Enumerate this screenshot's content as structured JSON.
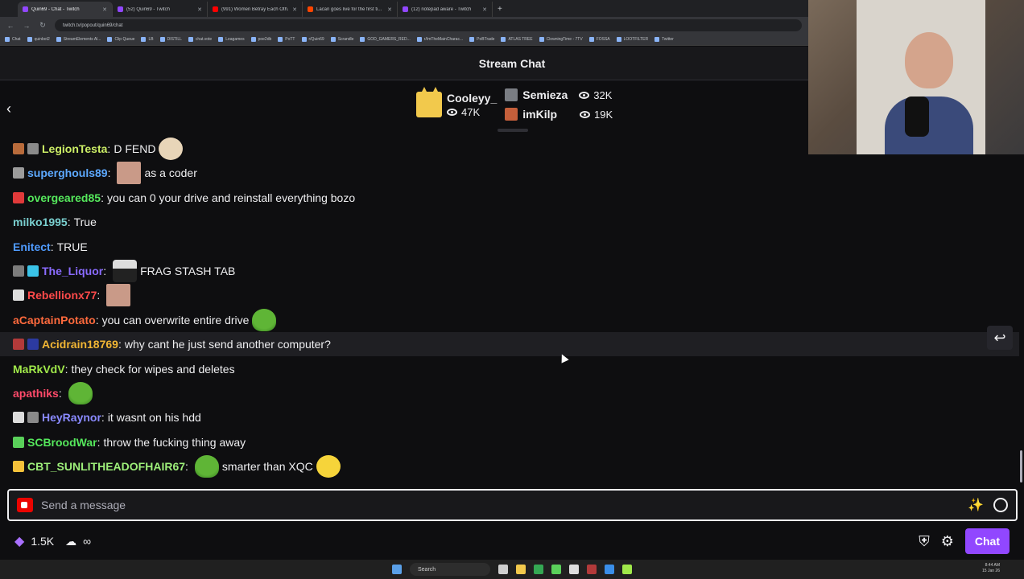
{
  "browser": {
    "tabs": [
      {
        "title": "Quin69 - Chat - Twitch",
        "active": true,
        "fav": "twitch"
      },
      {
        "title": "(52) Quin69 - Twitch",
        "active": false,
        "fav": "twitch"
      },
      {
        "title": "(991) Women Betray Each Oth...",
        "active": false,
        "fav": "youtube"
      },
      {
        "title": "Lacari goes live for the first ti...",
        "active": false,
        "fav": "reddit"
      },
      {
        "title": "(12) notepad aware - Twitch",
        "active": false,
        "fav": "twitch"
      }
    ],
    "new_tab": "+",
    "url": "twitch.tv/popout/quin69/chat",
    "bookmarks": [
      "Chat",
      "quinbot2",
      "StreamElements Al...",
      "Clip Queue",
      "LB",
      "DISTILL",
      "chat.vote",
      "Leagames",
      "poe2db",
      "PoTT",
      "r/Quin69",
      "Scrandle",
      "GOD_GAMERS_RED...",
      "r/ImTheMainCharac...",
      "PoBTrade",
      "ATLAS TREE",
      "ClowningTime - 7TV",
      "FOSSA",
      "LOOTFILTER",
      "Twitter"
    ]
  },
  "header": {
    "title": "Stream Chat"
  },
  "hype_train": {
    "top": {
      "name": "Cooleyy_",
      "viewers": "47K"
    },
    "others": [
      {
        "name": "Semieza",
        "viewers": "32K"
      },
      {
        "name": "imKilp",
        "viewers": "19K"
      }
    ]
  },
  "messages": [
    {
      "user": "LegionTesta",
      "color": "#ccee66",
      "text": "D FEND",
      "emote_before": false,
      "emote_after": "troll",
      "badges": [
        "#b86b3b",
        "#8a8a8a"
      ]
    },
    {
      "user": "superghouls89",
      "color": "#5da9ff",
      "text": "as a coder",
      "emote_before": "face",
      "emote_after": false,
      "badges": [
        "#9b9b9b"
      ]
    },
    {
      "user": "overgeared85",
      "color": "#55e85c",
      "text": "you can 0 your drive and reinstall everything bozo",
      "emote_before": false,
      "emote_after": false,
      "badges": [
        "#e03a3a"
      ]
    },
    {
      "user": "milko1995",
      "color": "#7ad0d0",
      "text": "True",
      "emote_before": false,
      "emote_after": false,
      "badges": []
    },
    {
      "user": "Enitect",
      "color": "#4f9bff",
      "text": "TRUE",
      "emote_before": false,
      "emote_after": false,
      "badges": []
    },
    {
      "user": "The_Liquor",
      "color": "#8a6bff",
      "text": "FRAG STASH TAB",
      "emote_before": "suit",
      "emote_after": false,
      "badges": [
        "#7c7c7c",
        "#3ac3e8"
      ]
    },
    {
      "user": "Rebellionx77",
      "color": "#ff4a4a",
      "text": "",
      "emote_before": false,
      "emote_after": "face",
      "badges": [
        "#dddddd"
      ]
    },
    {
      "user": "aCaptainPotato",
      "color": "#ff6a3d",
      "text": "you can overwrite entire drive",
      "emote_before": false,
      "emote_after": "pepe",
      "badges": []
    },
    {
      "user": "Acidrain18769",
      "color": "#f2b634",
      "text": "why cant he just send another computer?",
      "emote_before": false,
      "emote_after": false,
      "badges": [
        "#b23a3a",
        "#2c3aa0"
      ],
      "hover": true
    },
    {
      "user": "MaRkVdV",
      "color": "#a0e84a",
      "text": "they check for wipes and deletes",
      "emote_before": false,
      "emote_after": false,
      "badges": []
    },
    {
      "user": "apathiks",
      "color": "#ff4a6a",
      "text": "",
      "emote_before": false,
      "emote_after": "pepe",
      "badges": []
    },
    {
      "user": "HeyRaynor",
      "color": "#8a8aff",
      "text": "it wasnt on his hdd",
      "emote_before": false,
      "emote_after": false,
      "badges": [
        "#dddddd",
        "#8a8a8a"
      ]
    },
    {
      "user": "SCBroodWar",
      "color": "#55e85c",
      "text": "throw the fucking thing away",
      "emote_before": false,
      "emote_after": false,
      "badges": [
        "#5ad05a"
      ]
    },
    {
      "user": "CBT_SUNLITHEADOFHAIR67",
      "color": "#9ef07a",
      "text": "smarter than XQC",
      "emote_before": "pepe",
      "emote_after": "laugh",
      "badges": [
        "#f6c23a"
      ]
    }
  ],
  "input": {
    "placeholder": "Send a message"
  },
  "bottom": {
    "points": "1.5K",
    "infinity": "∞",
    "chat_button": "Chat"
  },
  "taskbar": {
    "search": "Search",
    "time": "8:44 AM",
    "date": "15 Jan 26"
  },
  "icons": {
    "back": "chevron-left-icon",
    "reply": "reply-icon",
    "shield": "shield-icon",
    "settings": "gear-icon"
  }
}
